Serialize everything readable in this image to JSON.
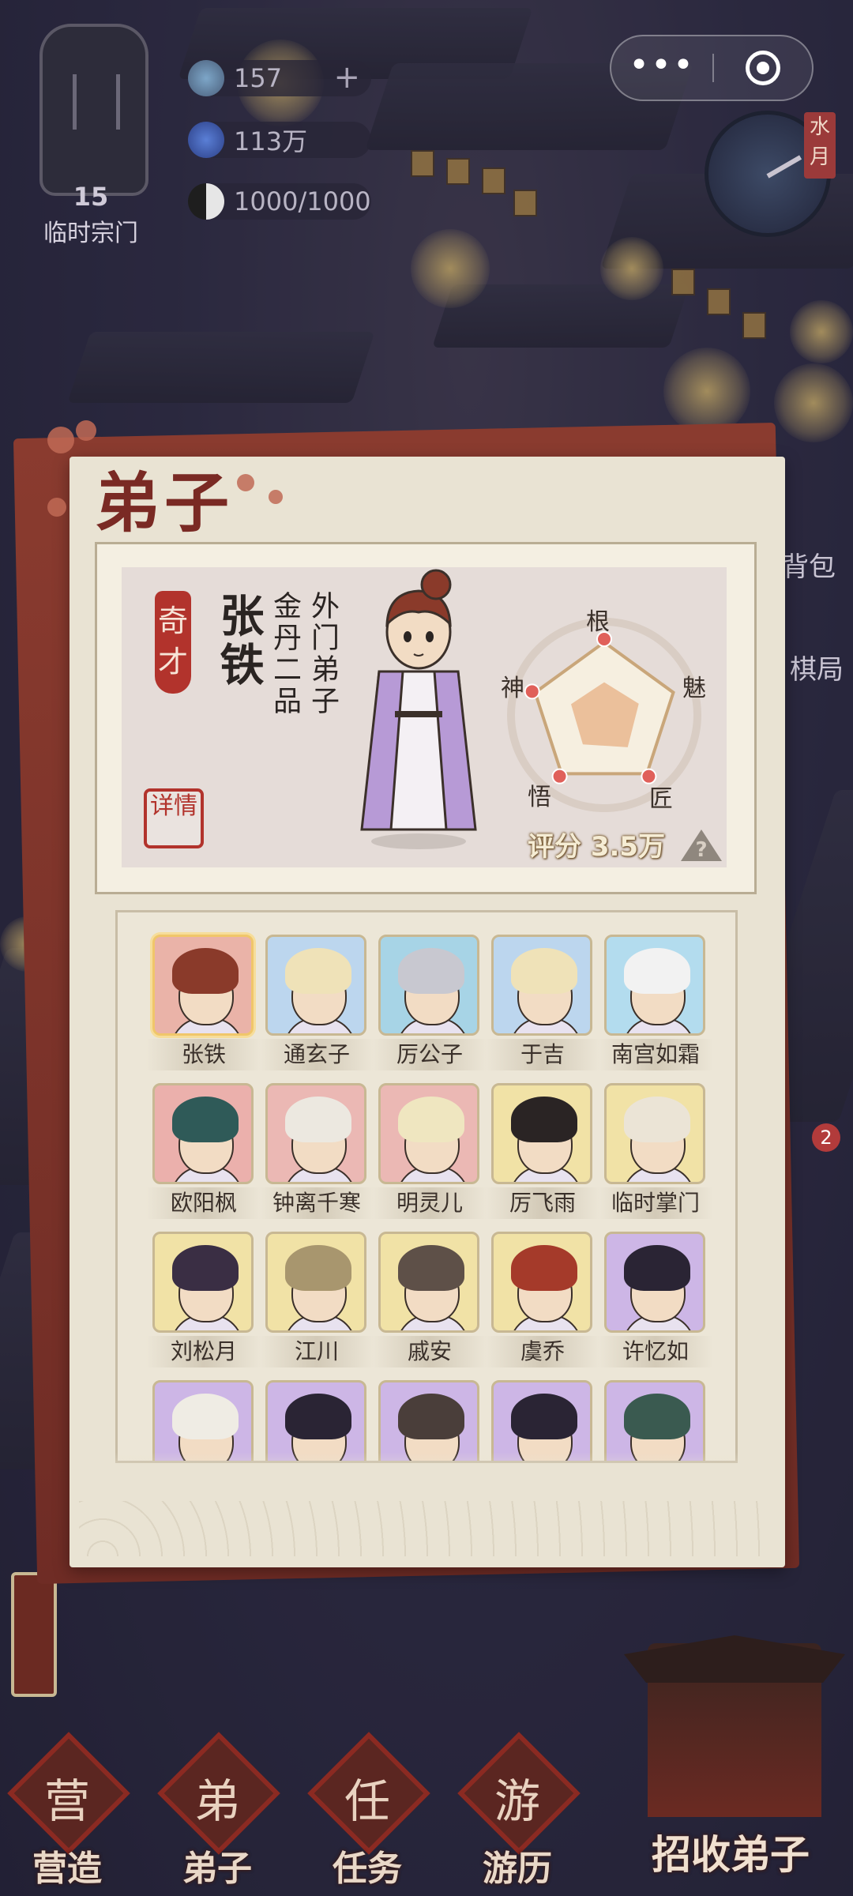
{
  "hud": {
    "sect_level": "15",
    "sect_name": "临时宗门",
    "resources": [
      {
        "icon": "spirit-stone-icon",
        "value": "157",
        "has_plus": true
      },
      {
        "icon": "gem-icon",
        "value": "113万",
        "has_plus": false
      },
      {
        "icon": "yin-yang-icon",
        "value": "1000/1000",
        "has_plus": false
      }
    ],
    "capsule_more": "•••",
    "clock_tag": "水月"
  },
  "side": {
    "right_labels": [
      "背包",
      "棋局"
    ],
    "badge_count": "2"
  },
  "panel": {
    "title": "弟子",
    "selected": {
      "rarity": "奇才",
      "name": "张铁",
      "rank": "金丹二品",
      "role": "外门弟子",
      "detail_label": "详情",
      "score_label": "评分 3.5万",
      "help_label": "?",
      "stats": [
        "根",
        "魅",
        "匠",
        "悟",
        "神"
      ],
      "stat_values": [
        0.45,
        0.5,
        0.55,
        0.5,
        0.48
      ]
    }
  },
  "roster": {
    "disciples": [
      {
        "name": "张铁",
        "bg": "#eab3a8",
        "hair": "#8a3a2a",
        "selected": true
      },
      {
        "name": "通玄子",
        "bg": "#bcd6ee",
        "hair": "#efe2b8",
        "selected": false
      },
      {
        "name": "厉公子",
        "bg": "#a7d4e6",
        "hair": "#c8c8d0",
        "selected": false
      },
      {
        "name": "于吉",
        "bg": "#bcd6ee",
        "hair": "#efe2b8",
        "selected": false
      },
      {
        "name": "南宫如霜",
        "bg": "#b3dcee",
        "hair": "#f2f2f2",
        "selected": false
      },
      {
        "name": "欧阳枫",
        "bg": "#ebb0ac",
        "hair": "#2f5a58",
        "selected": false
      },
      {
        "name": "钟离千寒",
        "bg": "#ebb8b4",
        "hair": "#ece8e0",
        "selected": false
      },
      {
        "name": "明灵儿",
        "bg": "#ebb8b4",
        "hair": "#efe6c0",
        "selected": false
      },
      {
        "name": "厉飞雨",
        "bg": "#f1e2a6",
        "hair": "#2a2424",
        "selected": false
      },
      {
        "name": "临时掌门",
        "bg": "#f1e2a6",
        "hair": "#ebe4d6",
        "selected": false
      },
      {
        "name": "刘松月",
        "bg": "#f1e2a6",
        "hair": "#3a2e44",
        "selected": false
      },
      {
        "name": "江川",
        "bg": "#f1e2a6",
        "hair": "#a8966e",
        "selected": false
      },
      {
        "name": "戚安",
        "bg": "#f1e2a6",
        "hair": "#5e5048",
        "selected": false
      },
      {
        "name": "虞乔",
        "bg": "#f1e2a6",
        "hair": "#a53a2a",
        "selected": false
      },
      {
        "name": "许忆如",
        "bg": "#cdb6e6",
        "hair": "#2a2434",
        "selected": false
      },
      {
        "name": "",
        "bg": "#cdb6e6",
        "hair": "#efece4",
        "selected": false
      },
      {
        "name": "",
        "bg": "#cdb6e6",
        "hair": "#2a2434",
        "selected": false
      },
      {
        "name": "",
        "bg": "#cdb6e6",
        "hair": "#4a3e3a",
        "selected": false
      },
      {
        "name": "",
        "bg": "#cdb6e6",
        "hair": "#2a2434",
        "selected": false
      },
      {
        "name": "",
        "bg": "#cdb6e6",
        "hair": "#3a5a50",
        "selected": false
      }
    ]
  },
  "nav": {
    "items": [
      {
        "label": "营造",
        "glyph": "营",
        "icon": "build-icon"
      },
      {
        "label": "弟子",
        "glyph": "弟",
        "icon": "disciple-icon"
      },
      {
        "label": "任务",
        "glyph": "任",
        "icon": "task-icon"
      },
      {
        "label": "游历",
        "glyph": "游",
        "icon": "travel-icon"
      }
    ],
    "recruit_label": "招收弟子"
  },
  "colors": {
    "panel_bg": "#e9e3d3",
    "accent_red": "#b2332c",
    "title_red": "#7a2a24"
  }
}
